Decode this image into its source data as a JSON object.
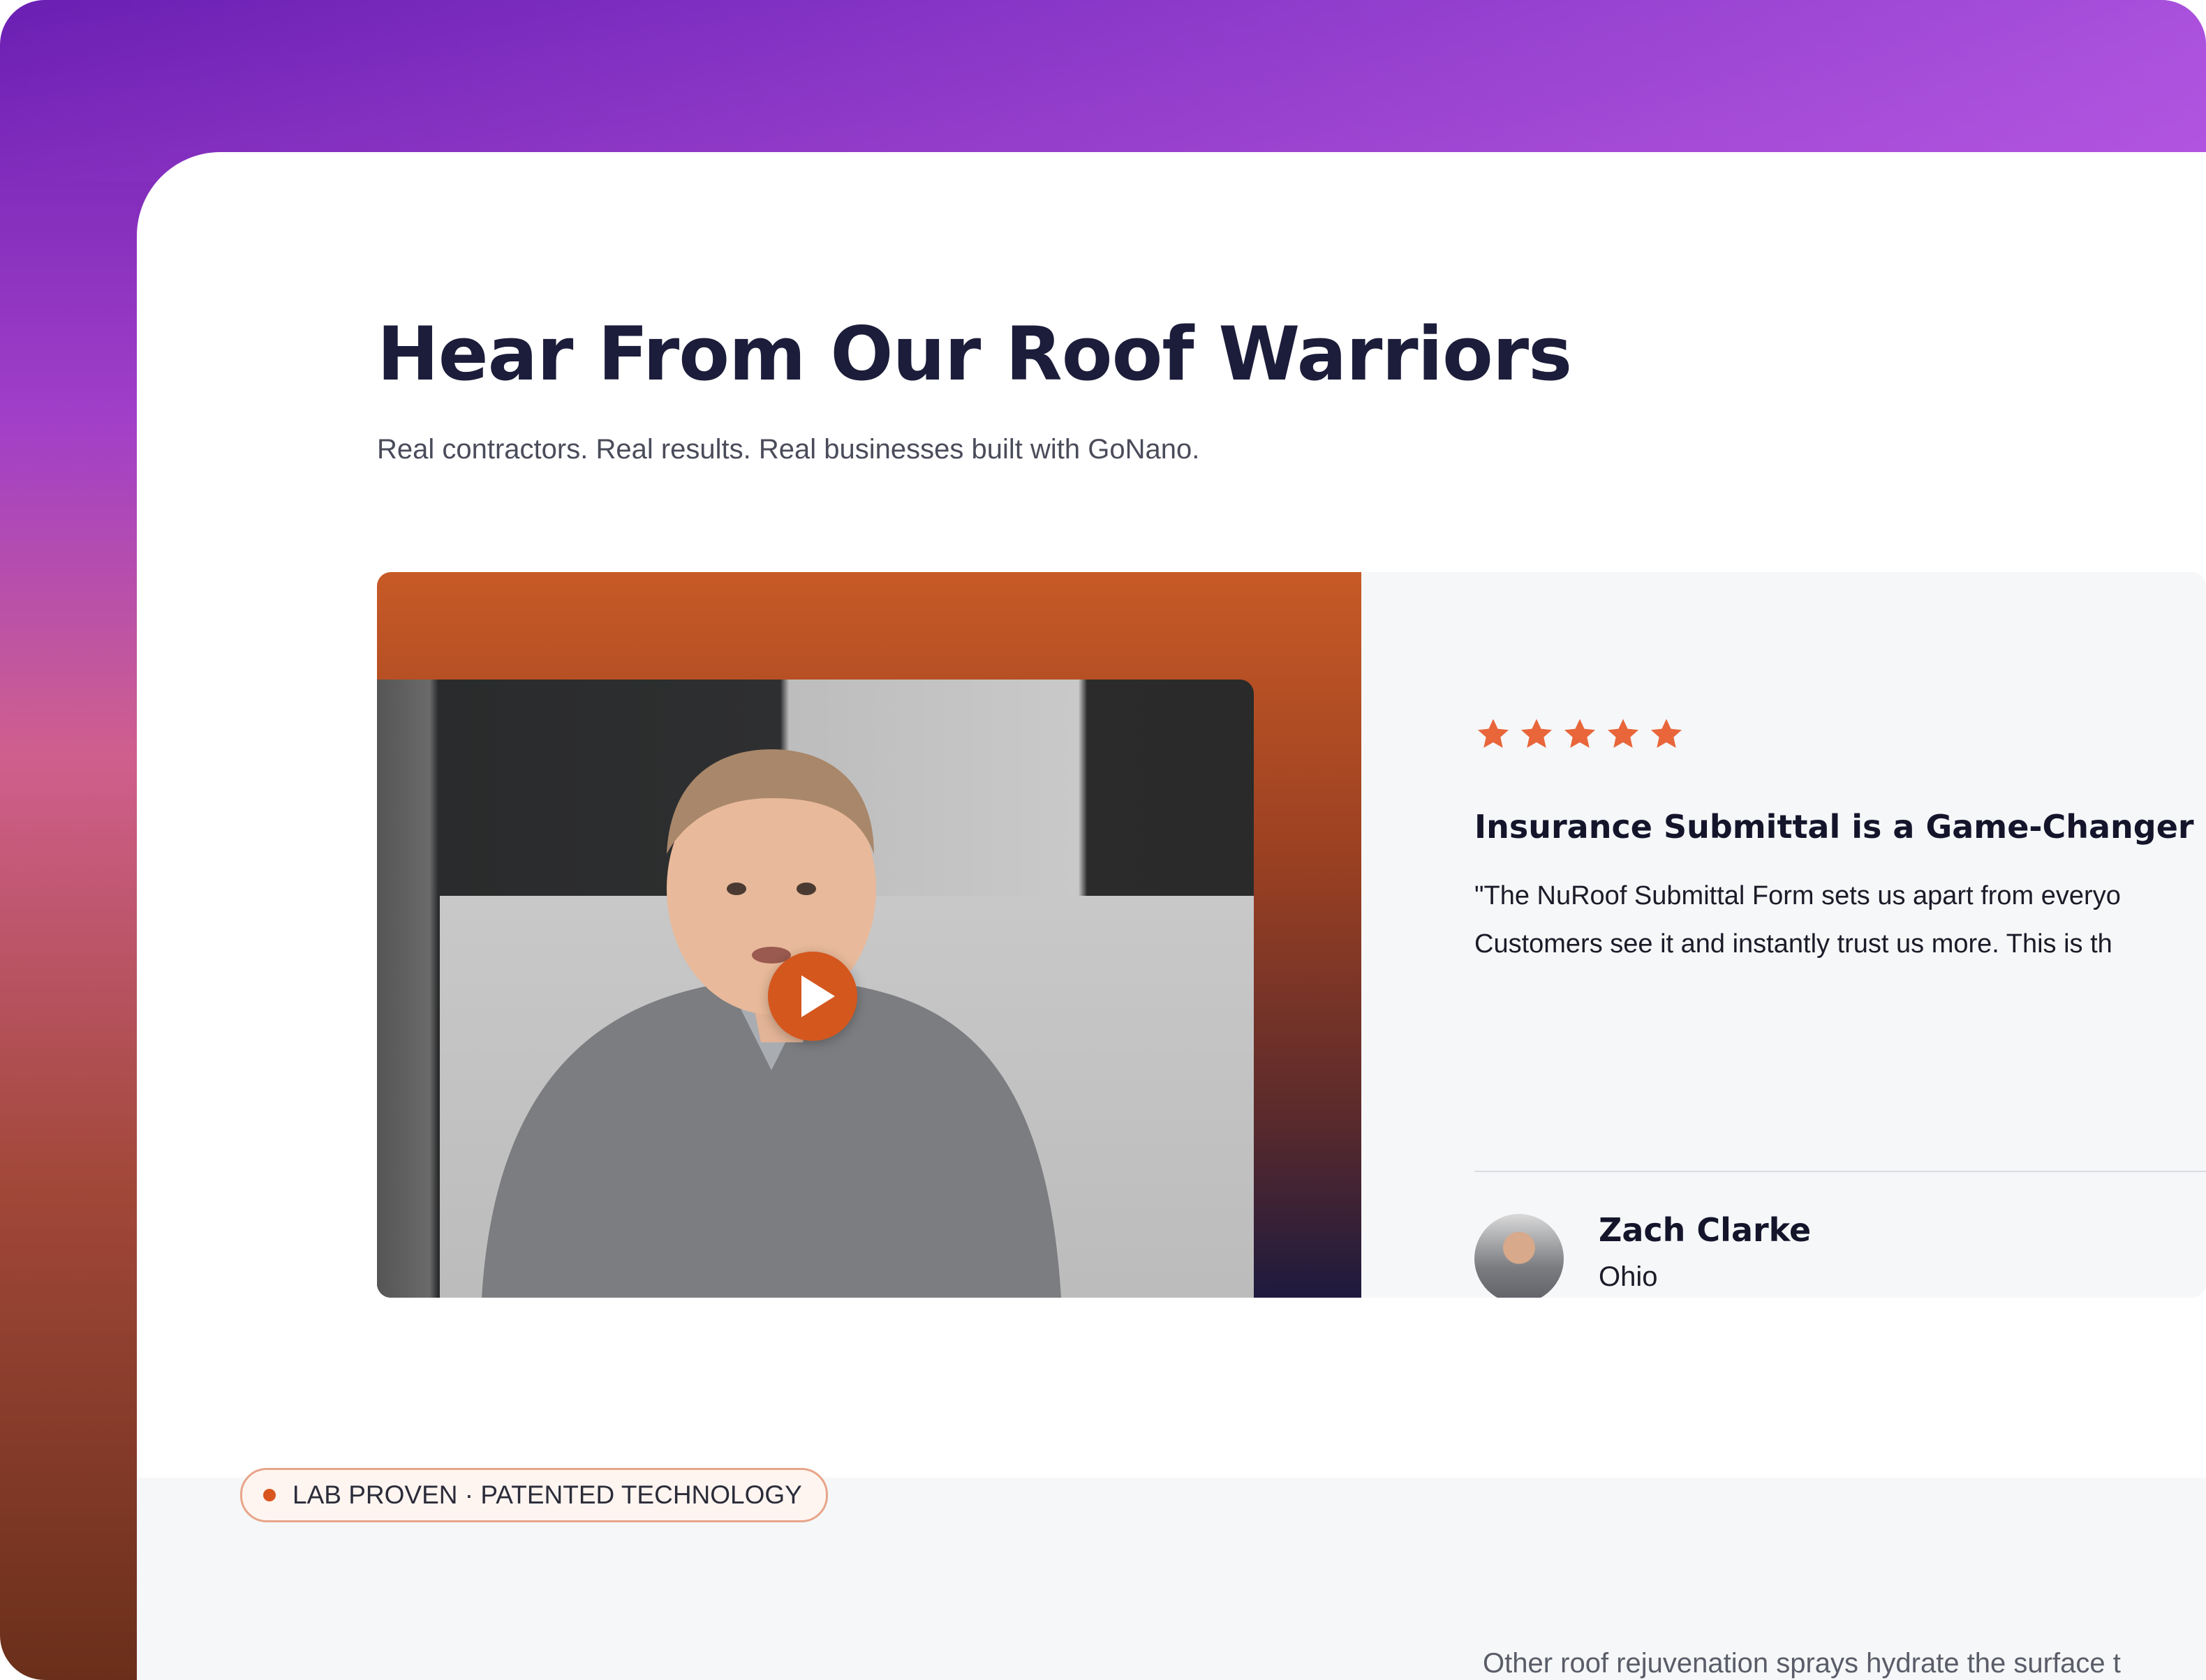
{
  "header": {
    "title": "Hear From Our Roof Warriors",
    "subtitle": "Real contractors. Real results. Real businesses built with GoNano."
  },
  "testimonial": {
    "video": {
      "play_icon": "play-icon",
      "accent": "#d4571e"
    },
    "rating": {
      "value": 5,
      "max": 5,
      "star_color": "#e8663a",
      "icon": "star-icon"
    },
    "title": "Insurance Submittal is a Game-Changer",
    "quote_line_1": "\"The NuRoof Submittal Form sets us apart from everyo",
    "quote_line_2": "Customers see it and instantly trust us more. This is th",
    "reviewer": {
      "name": "Zach Clarke",
      "location": "Ohio"
    }
  },
  "next_section": {
    "badge": "LAB PROVEN · PATENTED TECHNOLOGY",
    "badge_color": "#d9551f",
    "text": "Other roof rejuvenation sprays hydrate the surface t"
  }
}
